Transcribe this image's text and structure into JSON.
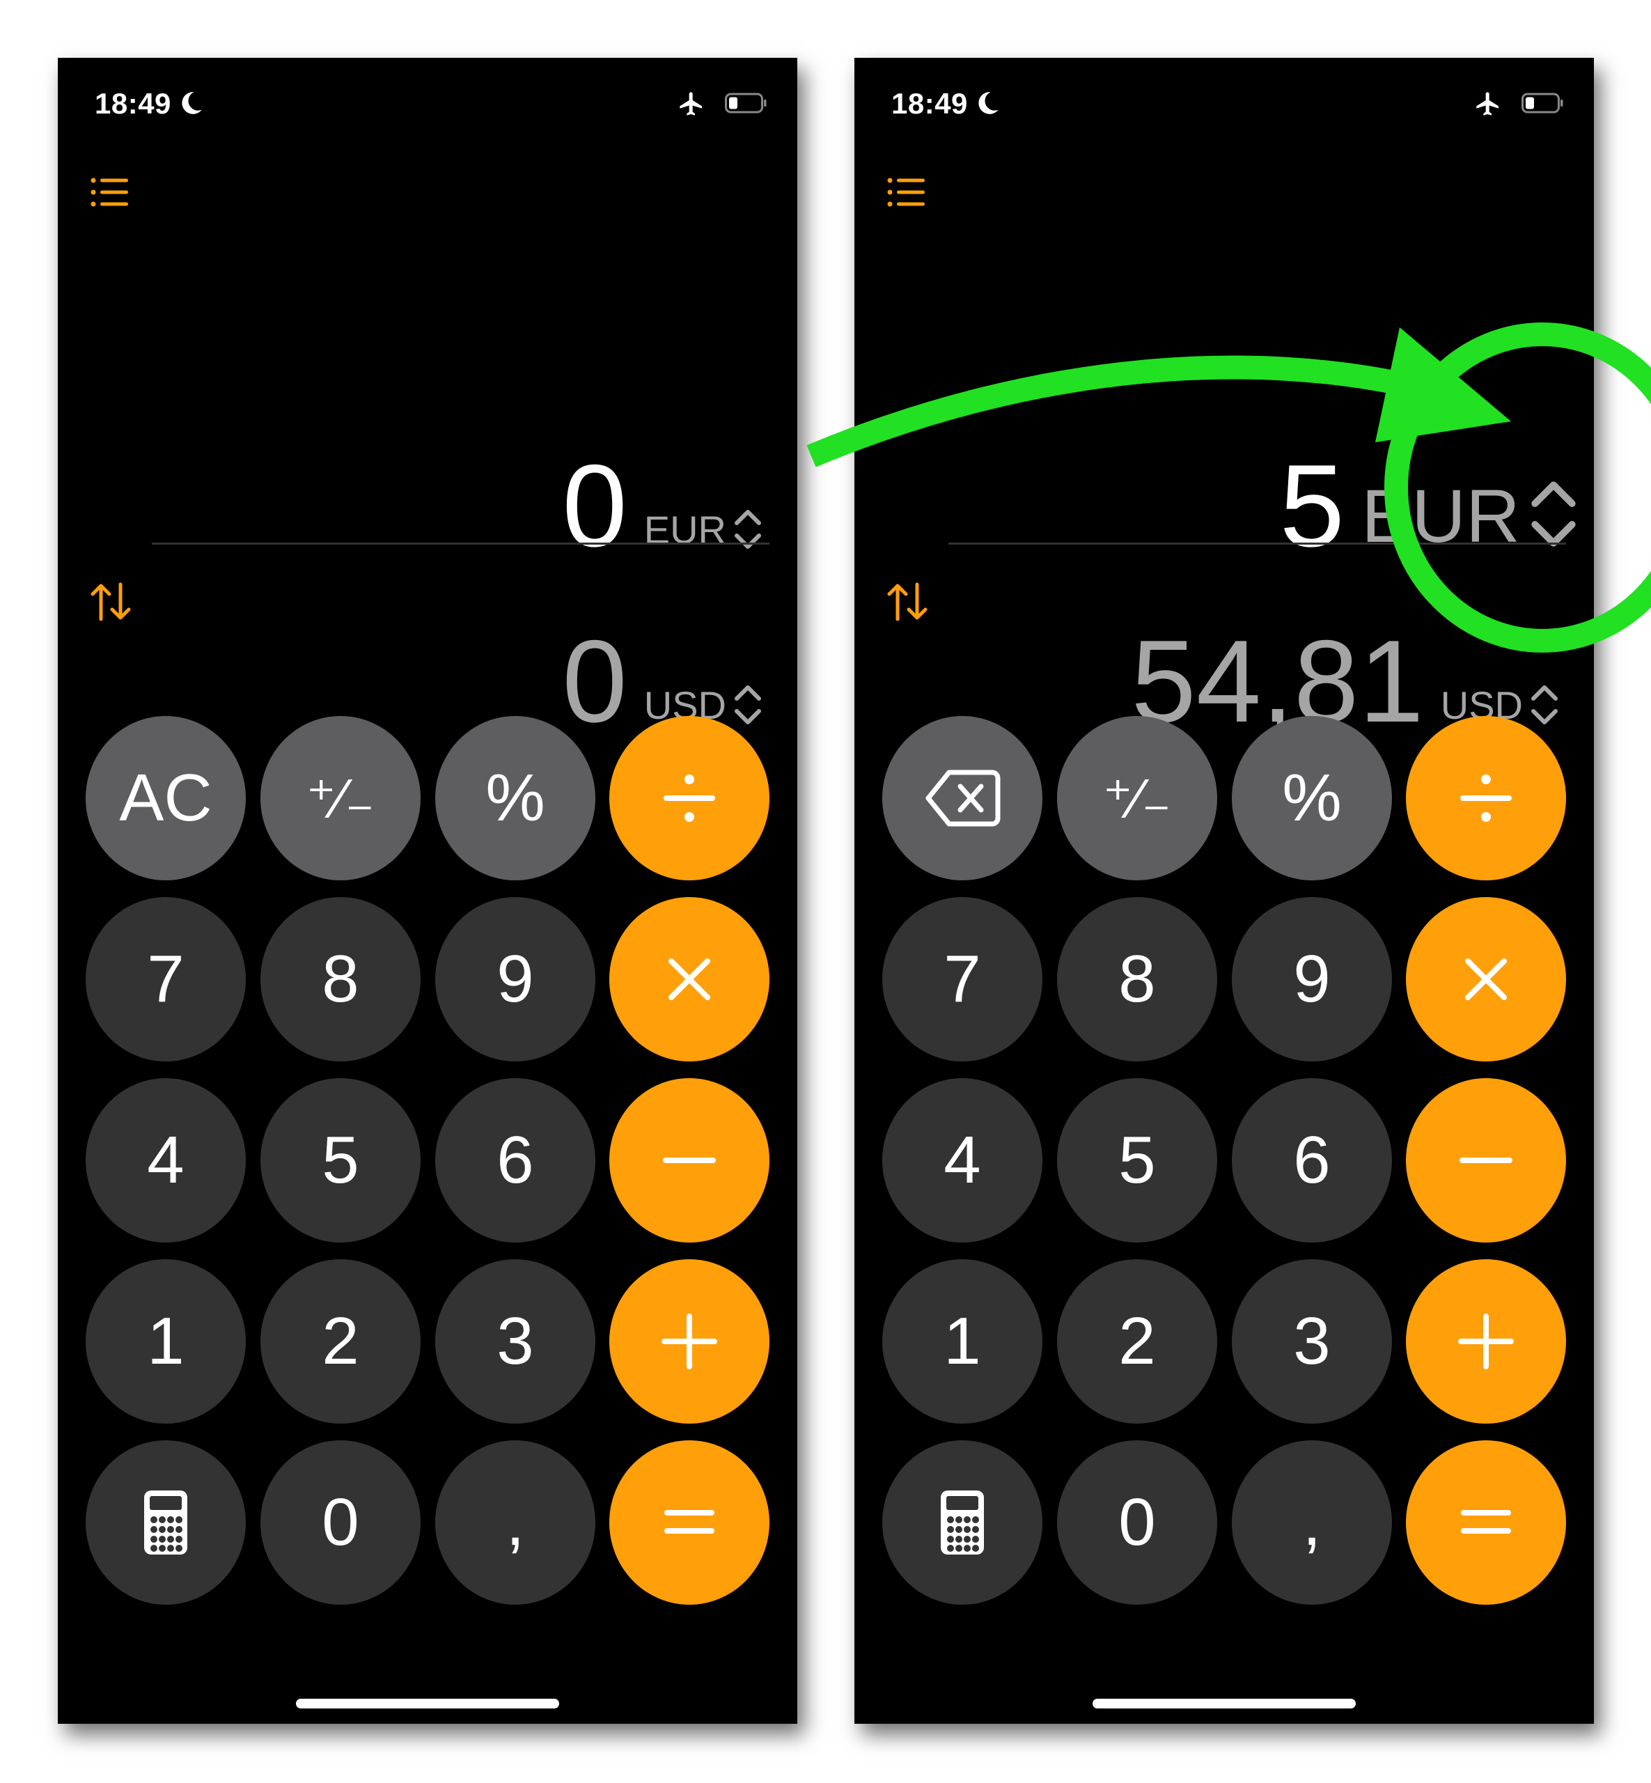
{
  "status_bar": {
    "time": "18:49"
  },
  "phones": [
    {
      "id": "left",
      "display": {
        "top": {
          "value": "0",
          "currency": "EUR"
        },
        "bottom": {
          "value": "0",
          "currency": "USD"
        }
      },
      "keys": {
        "clear": "AC",
        "sign": "⁺∕₋",
        "percent": "%",
        "seven": "7",
        "eight": "8",
        "nine": "9",
        "four": "4",
        "five": "5",
        "six": "6",
        "one": "1",
        "two": "2",
        "three": "3",
        "zero": "0",
        "decimal": ","
      }
    },
    {
      "id": "right",
      "display": {
        "top": {
          "value": "5",
          "currency": "EUR"
        },
        "bottom": {
          "value": "54,81",
          "currency": "USD"
        }
      },
      "keys": {
        "sign": "⁺∕₋",
        "percent": "%",
        "seven": "7",
        "eight": "8",
        "nine": "9",
        "four": "4",
        "five": "5",
        "six": "6",
        "one": "1",
        "two": "2",
        "three": "3",
        "zero": "0",
        "decimal": ","
      }
    }
  ],
  "colors": {
    "accent": "#ff9f0a",
    "key_dark": "#333333",
    "key_gray": "#5e5e60",
    "annotation": "#22e022"
  },
  "icons": {
    "menu": "list-icon",
    "swap": "swap-arrows-icon",
    "backspace": "backspace-icon",
    "calculator": "calculator-icon",
    "currency_picker": "chevron-updown-icon"
  }
}
